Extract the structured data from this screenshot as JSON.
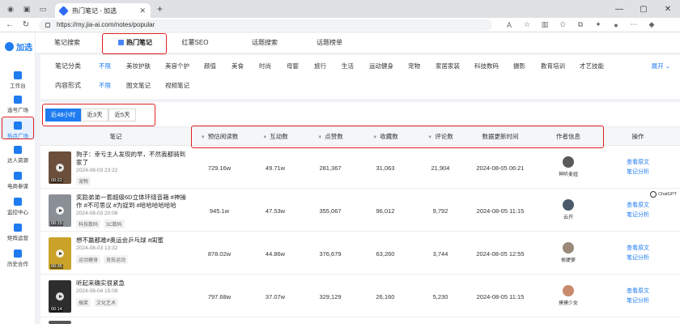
{
  "browser": {
    "tab_title": "热门笔记 - 加选",
    "url": "https://my.jia-ai.com/notes/popular"
  },
  "brand": {
    "name": "加选"
  },
  "sidebar": {
    "items": [
      {
        "label": "工作台"
      },
      {
        "label": "选号广场"
      },
      {
        "label": "热点广场"
      },
      {
        "label": "达人资源"
      },
      {
        "label": "电商参谋"
      },
      {
        "label": "监控中心"
      },
      {
        "label": "矩阵运营"
      },
      {
        "label": "历史合作"
      }
    ]
  },
  "topnav": {
    "tabs": [
      {
        "label": "笔记搜索"
      },
      {
        "label": "热门笔记"
      },
      {
        "label": "红薯SEO"
      },
      {
        "label": "话题搜索"
      },
      {
        "label": "话题榜单"
      }
    ]
  },
  "filters": {
    "category_label": "笔记分类",
    "categories": [
      "不限",
      "美妆护肤",
      "美容个护",
      "颜值",
      "美食",
      "时尚",
      "母婴",
      "旅行",
      "生活",
      "运动健身",
      "宠物",
      "家居家装",
      "科技数码",
      "摄影",
      "教育培训",
      "才艺技能"
    ],
    "expand_label": "展开",
    "form_label": "内容形式",
    "forms": [
      "不限",
      "图文笔记",
      "视频笔记"
    ]
  },
  "time_filters": [
    "近48小时",
    "近3天",
    "近5天"
  ],
  "table": {
    "headers": {
      "note": "笔记",
      "reads": "预估阅读数",
      "interactions": "互动数",
      "likes": "点赞数",
      "collects": "收藏数",
      "comments": "评论数",
      "updated": "数据更新时间",
      "author": "作者信息",
      "ops": "操作"
    },
    "rows": [
      {
        "title": "狗子：幸亏主人发现的早，不然我都骑到家了",
        "date": "2024-08-03 23:22",
        "duration": "00:22",
        "tags": [
          "宠物"
        ],
        "reads": "729.16w",
        "interactions": "49.71w",
        "likes": "281,367",
        "collects": "31,063",
        "comments": "21,904",
        "updated": "2024-08-05 06:21",
        "author": "神听麦妞"
      },
      {
        "title": "奖励弟弟一套超级6D立体环绕音箱 #神操作 #不可思议 #为捉到 #哈哈哈哈哈哈",
        "date": "2024-08-03 20:08",
        "duration": "00:15",
        "tags": [
          "科技数码",
          "3C数码"
        ],
        "reads": "945.1w",
        "interactions": "47.53w",
        "likes": "355,067",
        "collects": "96,012",
        "comments": "9,792",
        "updated": "2024-08-05 11:15",
        "author": "云开"
      },
      {
        "title": "想不赢都难#奥运会乒乓球 #闺蜜",
        "date": "2024-08-03 13:32",
        "duration": "00:35",
        "tags": [
          "运动健身",
          "竞技运动"
        ],
        "reads": "878.02w",
        "interactions": "44.86w",
        "likes": "376,679",
        "collects": "63,260",
        "comments": "3,744",
        "updated": "2024-08-05 12:55",
        "author": "侯婕萝"
      },
      {
        "title": "听起来确实很紧急",
        "date": "2024-08-04 15:09",
        "duration": "00:14",
        "tags": [
          "搞笑",
          "文化艺术"
        ],
        "reads": "797.68w",
        "interactions": "37.07w",
        "likes": "329,129",
        "collects": "26,160",
        "comments": "5,230",
        "updated": "2024-08-05 11:15",
        "author": "摸摸少女"
      }
    ],
    "op_view": "查看原文",
    "op_analyze": "笔记分析"
  },
  "floating_badge": "ChatGPT"
}
